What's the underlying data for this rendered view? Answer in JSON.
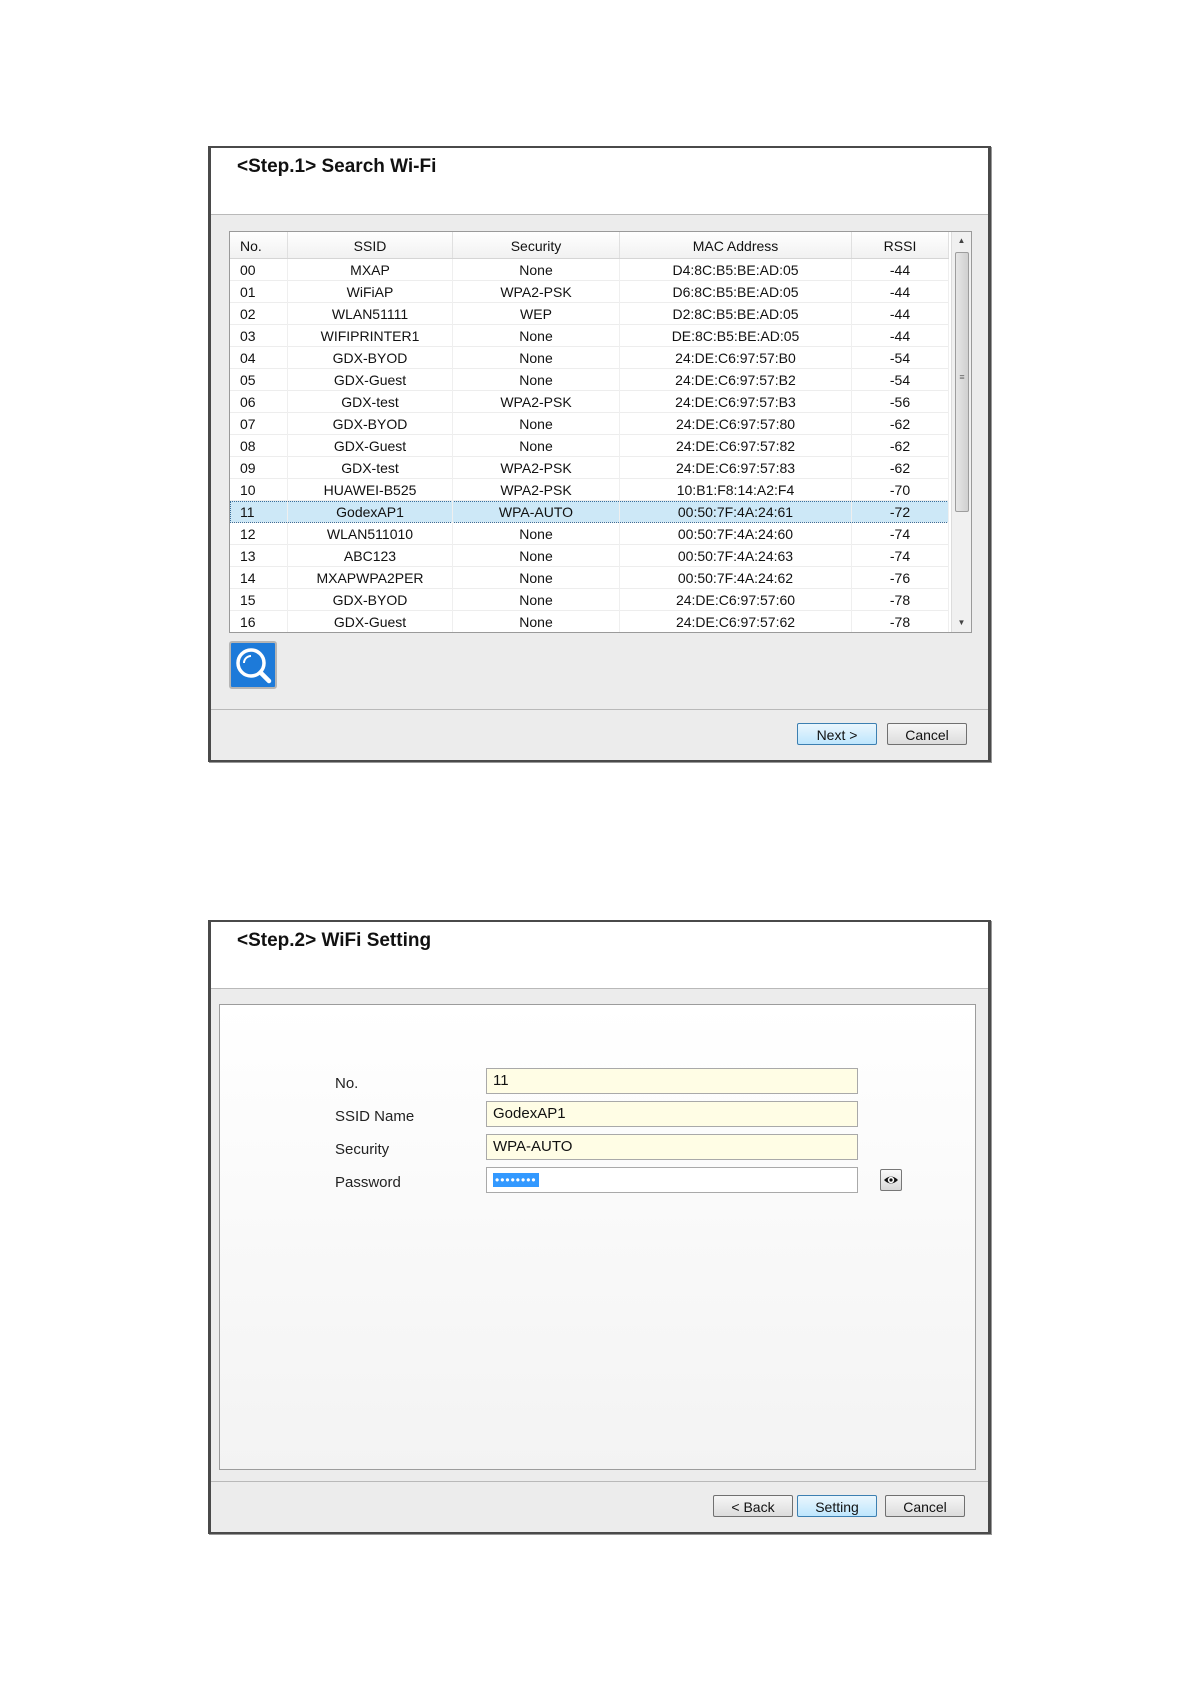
{
  "step1": {
    "title": "<Step.1>  Search Wi-Fi",
    "columns": [
      "No.",
      "SSID",
      "Security",
      "MAC Address",
      "RSSI"
    ],
    "selected_index": 11,
    "rows": [
      {
        "no": "00",
        "ssid": "MXAP",
        "security": "None",
        "mac": "D4:8C:B5:BE:AD:05",
        "rssi": "-44"
      },
      {
        "no": "01",
        "ssid": "WiFiAP",
        "security": "WPA2-PSK",
        "mac": "D6:8C:B5:BE:AD:05",
        "rssi": "-44"
      },
      {
        "no": "02",
        "ssid": "WLAN51111",
        "security": "WEP",
        "mac": "D2:8C:B5:BE:AD:05",
        "rssi": "-44"
      },
      {
        "no": "03",
        "ssid": "WIFIPRINTER1",
        "security": "None",
        "mac": "DE:8C:B5:BE:AD:05",
        "rssi": "-44"
      },
      {
        "no": "04",
        "ssid": "GDX-BYOD",
        "security": "None",
        "mac": "24:DE:C6:97:57:B0",
        "rssi": "-54"
      },
      {
        "no": "05",
        "ssid": "GDX-Guest",
        "security": "None",
        "mac": "24:DE:C6:97:57:B2",
        "rssi": "-54"
      },
      {
        "no": "06",
        "ssid": "GDX-test",
        "security": "WPA2-PSK",
        "mac": "24:DE:C6:97:57:B3",
        "rssi": "-56"
      },
      {
        "no": "07",
        "ssid": "GDX-BYOD",
        "security": "None",
        "mac": "24:DE:C6:97:57:80",
        "rssi": "-62"
      },
      {
        "no": "08",
        "ssid": "GDX-Guest",
        "security": "None",
        "mac": "24:DE:C6:97:57:82",
        "rssi": "-62"
      },
      {
        "no": "09",
        "ssid": "GDX-test",
        "security": "WPA2-PSK",
        "mac": "24:DE:C6:97:57:83",
        "rssi": "-62"
      },
      {
        "no": "10",
        "ssid": "HUAWEI-B525",
        "security": "WPA2-PSK",
        "mac": "10:B1:F8:14:A2:F4",
        "rssi": "-70"
      },
      {
        "no": "11",
        "ssid": "GodexAP1",
        "security": "WPA-AUTO",
        "mac": "00:50:7F:4A:24:61",
        "rssi": "-72"
      },
      {
        "no": "12",
        "ssid": "WLAN511010",
        "security": "None",
        "mac": "00:50:7F:4A:24:60",
        "rssi": "-74"
      },
      {
        "no": "13",
        "ssid": "ABC123",
        "security": "None",
        "mac": "00:50:7F:4A:24:63",
        "rssi": "-74"
      },
      {
        "no": "14",
        "ssid": "MXAPWPA2PER",
        "security": "None",
        "mac": "00:50:7F:4A:24:62",
        "rssi": "-76"
      },
      {
        "no": "15",
        "ssid": "GDX-BYOD",
        "security": "None",
        "mac": "24:DE:C6:97:57:60",
        "rssi": "-78"
      },
      {
        "no": "16",
        "ssid": "GDX-Guest",
        "security": "None",
        "mac": "24:DE:C6:97:57:62",
        "rssi": "-78"
      }
    ],
    "search_icon": "magnifier-icon",
    "next_label": "Next >",
    "cancel_label": "Cancel"
  },
  "step2": {
    "title": "<Step.2> WiFi Setting",
    "labels": {
      "no": "No.",
      "ssid": "SSID Name",
      "security": "Security",
      "password": "Password"
    },
    "values": {
      "no": "11",
      "ssid": "GodexAP1",
      "security": "WPA-AUTO",
      "password_mask": "••••••••"
    },
    "eye_icon": "eye-icon",
    "back_label": "< Back",
    "setting_label": "Setting",
    "cancel_label": "Cancel"
  },
  "colors": {
    "accent": "#1d7ad9",
    "selection": "#cde8f7",
    "input_bg": "#fffde5"
  }
}
